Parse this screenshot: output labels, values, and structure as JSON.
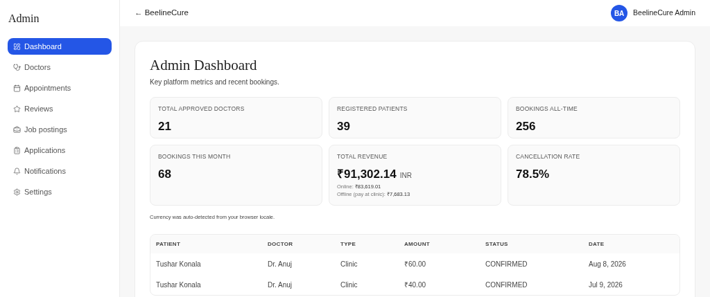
{
  "sidebar": {
    "title": "Admin",
    "items": [
      {
        "label": "Dashboard",
        "selected": true
      },
      {
        "label": "Doctors",
        "selected": false
      },
      {
        "label": "Appointments",
        "selected": false
      },
      {
        "label": "Reviews",
        "selected": false
      },
      {
        "label": "Job postings",
        "selected": false
      },
      {
        "label": "Applications",
        "selected": false
      },
      {
        "label": "Notifications",
        "selected": false
      },
      {
        "label": "Settings",
        "selected": false
      }
    ]
  },
  "header": {
    "back_link": "← BeelineCure",
    "avatar": "BA",
    "user": "BeelineCure Admin"
  },
  "page": {
    "title": "Admin Dashboard",
    "subtitle": "Key platform metrics and recent bookings.",
    "stats": [
      {
        "kind": "plain",
        "label": "TOTAL APPROVED DOCTORS",
        "value": "21"
      },
      {
        "kind": "plain",
        "label": "REGISTERED PATIENTS",
        "value": "39"
      },
      {
        "kind": "plain",
        "label": "BOOKINGS ALL-TIME",
        "value": "256"
      },
      {
        "kind": "plain",
        "label": "BOOKINGS THIS MONTH",
        "value": "68"
      },
      {
        "kind": "revenue",
        "label": "TOTAL REVENUE",
        "value": "₹91,302.14",
        "unit": "INR",
        "details": [
          {
            "label": "Online:",
            "value": "₹83,619.01"
          },
          {
            "label": "Offline (pay at clinic):",
            "value": "₹7,683.13"
          }
        ]
      },
      {
        "kind": "plain",
        "label": "CANCELLATION RATE",
        "value": "78.5%"
      }
    ],
    "note": "Currency was auto-detected from your browser locale.",
    "table": {
      "columns": [
        "PATIENT",
        "DOCTOR",
        "TYPE",
        "AMOUNT",
        "STATUS",
        "DATE"
      ],
      "rows": [
        [
          "Tushar Konala",
          "Dr. Anuj",
          "Clinic",
          "₹60.00",
          "CONFIRMED",
          "Aug 8, 2026"
        ],
        [
          "Tushar Konala",
          "Dr. Anuj",
          "Clinic",
          "₹40.00",
          "CONFIRMED",
          "Jul 9, 2026"
        ]
      ]
    }
  }
}
